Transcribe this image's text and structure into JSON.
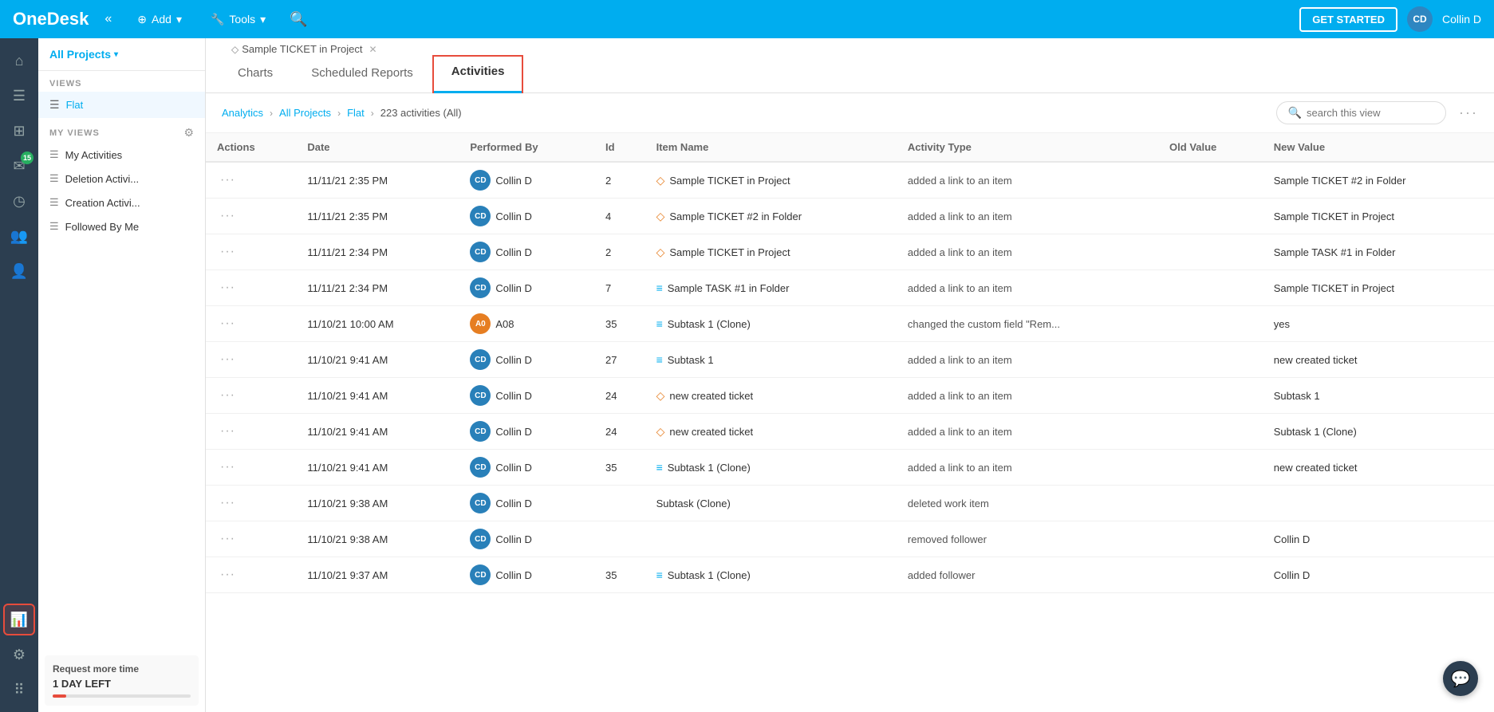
{
  "topNav": {
    "logo": "OneDesk",
    "collapseLabel": "«",
    "addLabel": "Add",
    "toolsLabel": "Tools",
    "getStartedLabel": "GET STARTED",
    "userInitials": "CD",
    "userName": "Collin D"
  },
  "leftPanel": {
    "allProjectsLabel": "All Projects",
    "viewsLabel": "VIEWS",
    "flatViewLabel": "Flat",
    "myViewsLabel": "MY VIEWS",
    "myViews": [
      {
        "label": "My Activities"
      },
      {
        "label": "Deletion Activi..."
      },
      {
        "label": "Creation Activi..."
      },
      {
        "label": "Followed By Me"
      }
    ],
    "requestTitle": "Request more time",
    "dayLeft": "1 DAY LEFT"
  },
  "tabs": [
    {
      "label": "Charts",
      "active": false
    },
    {
      "label": "Scheduled Reports",
      "active": false
    },
    {
      "label": "Activities",
      "active": true
    }
  ],
  "breadcrumb": {
    "analytics": "Analytics",
    "allProjects": "All Projects",
    "flat": "Flat",
    "count": "223 activities (All)"
  },
  "search": {
    "placeholder": "search this view"
  },
  "currentTab": "Sample TICKET in Project",
  "table": {
    "columns": [
      "Actions",
      "Date",
      "Performed By",
      "Id",
      "Item Name",
      "Activity Type",
      "Old Value",
      "New Value"
    ],
    "rows": [
      {
        "date": "11/11/21 2:35 PM",
        "performer": "Collin D",
        "performerInitials": "CD",
        "id": "2",
        "itemName": "Sample TICKET in Project",
        "itemType": "ticket",
        "activityType": "added a link to an item",
        "oldValue": "",
        "newValue": "Sample TICKET #2 in Folder"
      },
      {
        "date": "11/11/21 2:35 PM",
        "performer": "Collin D",
        "performerInitials": "CD",
        "id": "4",
        "itemName": "Sample TICKET #2 in Folder",
        "itemType": "ticket",
        "activityType": "added a link to an item",
        "oldValue": "",
        "newValue": "Sample TICKET in Project"
      },
      {
        "date": "11/11/21 2:34 PM",
        "performer": "Collin D",
        "performerInitials": "CD",
        "id": "2",
        "itemName": "Sample TICKET in Project",
        "itemType": "ticket",
        "activityType": "added a link to an item",
        "oldValue": "",
        "newValue": "Sample TASK #1 in Folder"
      },
      {
        "date": "11/11/21 2:34 PM",
        "performer": "Collin D",
        "performerInitials": "CD",
        "id": "7",
        "itemName": "Sample TASK #1 in Folder",
        "itemType": "task",
        "activityType": "added a link to an item",
        "oldValue": "",
        "newValue": "Sample TICKET in Project"
      },
      {
        "date": "11/10/21 10:00 AM",
        "performer": "A08",
        "performerInitials": "A0",
        "performerType": "orange",
        "id": "35",
        "itemName": "Subtask 1 (Clone)",
        "itemType": "task",
        "activityType": "changed the custom field \"Rem...",
        "oldValue": "",
        "newValue": "yes"
      },
      {
        "date": "11/10/21 9:41 AM",
        "performer": "Collin D",
        "performerInitials": "CD",
        "id": "27",
        "itemName": "Subtask 1",
        "itemType": "task",
        "activityType": "added a link to an item",
        "oldValue": "",
        "newValue": "new created ticket"
      },
      {
        "date": "11/10/21 9:41 AM",
        "performer": "Collin D",
        "performerInitials": "CD",
        "id": "24",
        "itemName": "new created ticket",
        "itemType": "ticket",
        "activityType": "added a link to an item",
        "oldValue": "",
        "newValue": "Subtask 1"
      },
      {
        "date": "11/10/21 9:41 AM",
        "performer": "Collin D",
        "performerInitials": "CD",
        "id": "24",
        "itemName": "new created ticket",
        "itemType": "ticket",
        "activityType": "added a link to an item",
        "oldValue": "",
        "newValue": "Subtask 1 (Clone)"
      },
      {
        "date": "11/10/21 9:41 AM",
        "performer": "Collin D",
        "performerInitials": "CD",
        "id": "35",
        "itemName": "Subtask 1 (Clone)",
        "itemType": "task",
        "activityType": "added a link to an item",
        "oldValue": "",
        "newValue": "new created ticket"
      },
      {
        "date": "11/10/21 9:38 AM",
        "performer": "Collin D",
        "performerInitials": "CD",
        "id": "",
        "itemName": "Subtask (Clone)",
        "itemType": "none",
        "activityType": "deleted work item",
        "oldValue": "",
        "newValue": ""
      },
      {
        "date": "11/10/21 9:38 AM",
        "performer": "Collin D",
        "performerInitials": "CD",
        "id": "",
        "itemName": "",
        "itemType": "none",
        "activityType": "removed follower",
        "oldValue": "",
        "newValue": "Collin D"
      },
      {
        "date": "11/10/21 9:37 AM",
        "performer": "Collin D",
        "performerInitials": "CD",
        "id": "35",
        "itemName": "Subtask 1 (Clone)",
        "itemType": "task",
        "activityType": "added follower",
        "oldValue": "",
        "newValue": "Collin D"
      }
    ]
  },
  "icons": {
    "ticket": "◇",
    "task": "≡",
    "menu": "≡",
    "search": "🔍",
    "chevronDown": "▾",
    "chevronRight": "›",
    "settings": "⚙",
    "chat": "💬"
  },
  "sidebarIcons": [
    {
      "name": "home-icon",
      "symbol": "⌂",
      "active": false
    },
    {
      "name": "list-icon",
      "symbol": "☰",
      "active": false
    },
    {
      "name": "grid-icon",
      "symbol": "⊞",
      "active": false
    },
    {
      "name": "messages-icon",
      "symbol": "✉",
      "active": false,
      "badge": "15"
    },
    {
      "name": "clock-icon",
      "symbol": "◷",
      "active": false
    },
    {
      "name": "users-icon",
      "symbol": "👥",
      "active": false
    },
    {
      "name": "person-icon",
      "symbol": "👤",
      "active": false
    },
    {
      "name": "analytics-icon",
      "symbol": "📊",
      "active": true,
      "isAnalytics": true
    },
    {
      "name": "gear-icon",
      "symbol": "⚙",
      "active": false
    },
    {
      "name": "apps-icon",
      "symbol": "⠿",
      "active": false
    }
  ]
}
